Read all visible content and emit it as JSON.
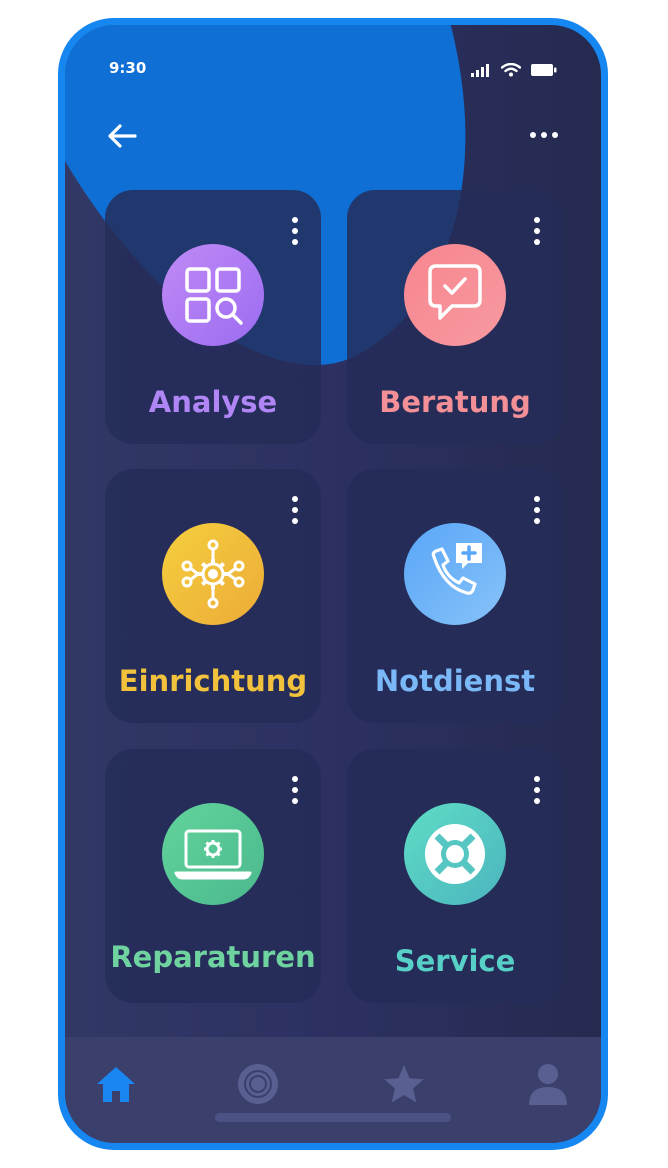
{
  "status": {
    "time": "9:30",
    "icons": [
      "signal-icon",
      "wifi-icon",
      "battery-icon"
    ]
  },
  "topbar": {
    "back_icon": "arrow-left-icon",
    "more_icon": "more-horizontal-icon"
  },
  "cards": [
    {
      "label": "Analyse",
      "icon": "apps-search-icon",
      "color": "#b085f5",
      "gradient": [
        "#c08af5",
        "#9b6cf2"
      ]
    },
    {
      "label": "Beratung",
      "icon": "chat-check-icon",
      "color": "#f38f96",
      "gradient": [
        "#f7858f",
        "#f79aa0"
      ]
    },
    {
      "label": "Einrichtung",
      "icon": "gear-network-icon",
      "color": "#f2c23c",
      "gradient": [
        "#f5cf3e",
        "#ecab38"
      ]
    },
    {
      "label": "Notdienst",
      "icon": "phone-plus-icon",
      "color": "#7ab8f7",
      "gradient": [
        "#5aa6f8",
        "#86c2f8"
      ]
    },
    {
      "label": "Reparaturen",
      "icon": "laptop-repair-icon",
      "color": "#6fd3a0",
      "gradient": [
        "#62d49b",
        "#4bb88e"
      ]
    },
    {
      "label": "Service",
      "icon": "lifebuoy-icon",
      "color": "#57d0c8",
      "gradient": [
        "#5fdcc6",
        "#4bb5be"
      ]
    }
  ],
  "nav": {
    "items": [
      {
        "name": "home",
        "icon": "home-icon",
        "active": true
      },
      {
        "name": "target",
        "icon": "target-icon",
        "active": false
      },
      {
        "name": "favorites",
        "icon": "star-icon",
        "active": false
      },
      {
        "name": "profile",
        "icon": "user-icon",
        "active": false
      }
    ],
    "active_color": "#1a86f2",
    "inactive_color": "#5a5f91"
  }
}
